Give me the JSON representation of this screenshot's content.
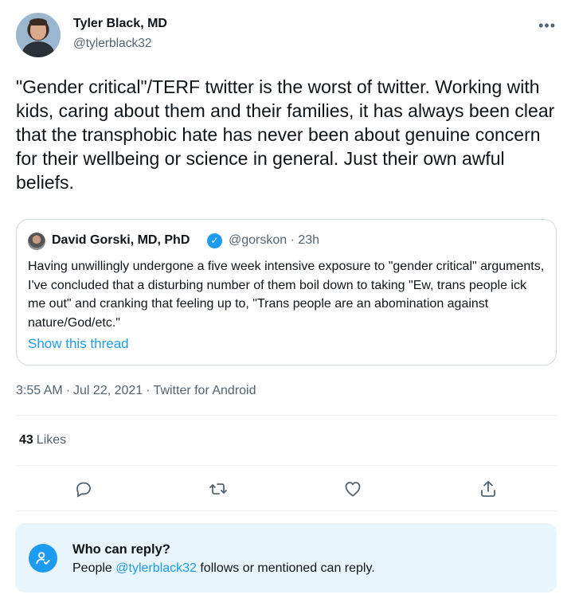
{
  "author": {
    "name": "Tyler Black, MD",
    "handle": "@tylerblack32",
    "more_icon": "ellipsis-icon"
  },
  "tweet": {
    "text": "\"Gender critical\"/TERF twitter is the worst of twitter. Working with kids, caring about them and their families, it has always been clear that the transphobic hate has never been about genuine concern for their wellbeing or science in general. Just their own awful beliefs.",
    "time": "3:55 AM",
    "date": "Jul 22, 2021",
    "source": "Twitter for Android",
    "separator": "·"
  },
  "quote": {
    "name": "David Gorski, MD, PhD",
    "verified_icon": "verified-badge-icon",
    "handle_time": "@gorskon · 23h",
    "text": "Having unwillingly undergone a five week intensive exposure to \"gender critical\" arguments, I've concluded that a disturbing number of them boil down to taking \"Ew, trans people ick me out\" and cranking that feeling up to, \"Trans people are an abomination against nature/God/etc.\"",
    "link": "Show this thread"
  },
  "stats": {
    "likes_count": "43",
    "likes_label": "Likes"
  },
  "actions": [
    {
      "icon": "reply-icon"
    },
    {
      "icon": "retweet-icon"
    },
    {
      "icon": "heart-icon"
    },
    {
      "icon": "share-icon"
    }
  ],
  "reply_notice": {
    "title": "Who can reply?",
    "prefix": "People",
    "mention": "@tylerblack32",
    "suffix": "follows or mentioned can reply."
  },
  "colors": {
    "accent": "#1d9bf0",
    "secondary_text": "#536471",
    "reply_bg": "#e8f5fd"
  }
}
